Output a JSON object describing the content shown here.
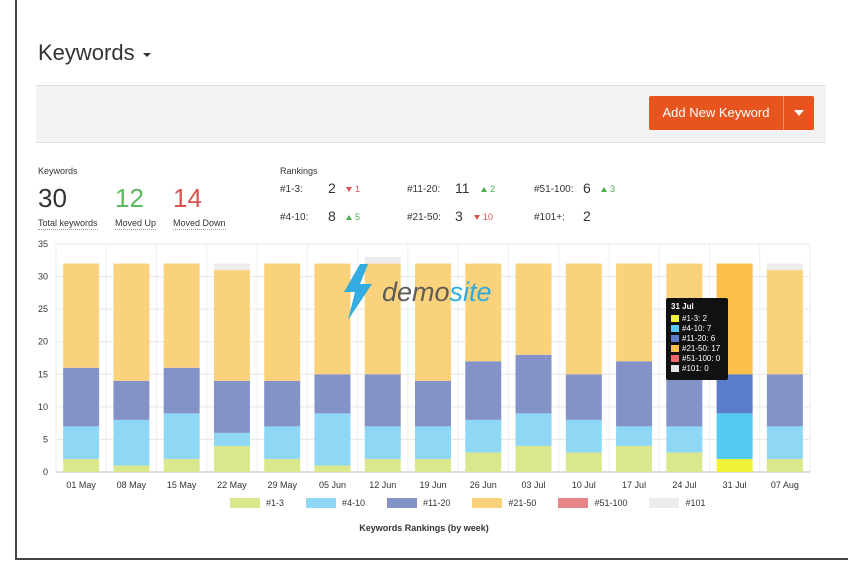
{
  "header": {
    "title": "Keywords"
  },
  "toolbar": {
    "add_label": "Add New Keyword"
  },
  "stats": {
    "section_label": "Keywords",
    "total": {
      "value": "30",
      "label": "Total keywords"
    },
    "up": {
      "value": "12",
      "label": "Moved Up"
    },
    "down": {
      "value": "14",
      "label": "Moved Down"
    }
  },
  "rankings": {
    "section_label": "Rankings",
    "items": [
      {
        "label": "#1-3:",
        "value": "2",
        "change": "1",
        "dir": "down"
      },
      {
        "label": "#4-10:",
        "value": "8",
        "change": "5",
        "dir": "up"
      },
      {
        "label": "#11-20:",
        "value": "11",
        "change": "2",
        "dir": "up"
      },
      {
        "label": "#21-50:",
        "value": "3",
        "change": "10",
        "dir": "down"
      },
      {
        "label": "#51-100:",
        "value": "6",
        "change": "3",
        "dir": "up"
      },
      {
        "label": "#101+:",
        "value": "2",
        "change": "",
        "dir": ""
      }
    ]
  },
  "watermark": {
    "brand": "demosite"
  },
  "tooltip": {
    "title": "31 Jul",
    "rows": [
      "#1-3: 2",
      "#4-10: 7",
      "#11-20: 6",
      "#21-50: 17",
      "#51-100: 0",
      "#101: 0"
    ]
  },
  "colors": {
    "c1_3": "#d9e88c",
    "c4_10": "#8fd8f5",
    "c11_20": "#8393c7",
    "c21_50": "#fbd27c",
    "c51_100": "#e8868a",
    "c101": "#ececec",
    "accent": "#e8541e"
  },
  "chart_data": {
    "type": "bar",
    "stacked": true,
    "title": "Keywords Rankings (by week)",
    "categories": [
      "01 May",
      "08 May",
      "15 May",
      "22 May",
      "29 May",
      "05 Jun",
      "12 Jun",
      "19 Jun",
      "26 Jun",
      "03 Jul",
      "10 Jul",
      "17 Jul",
      "24 Jul",
      "31 Jul",
      "07 Aug"
    ],
    "ylim": [
      0,
      35
    ],
    "yticks": [
      0,
      5,
      10,
      15,
      20,
      25,
      30,
      35
    ],
    "grid": true,
    "legend_position": "bottom",
    "highlight_category": "31 Jul",
    "series": [
      {
        "name": "#1-3",
        "color_key": "c1_3",
        "values": [
          2,
          1,
          2,
          4,
          2,
          1,
          2,
          2,
          3,
          4,
          3,
          4,
          3,
          2,
          2
        ]
      },
      {
        "name": "#4-10",
        "color_key": "c4_10",
        "values": [
          5,
          7,
          7,
          2,
          5,
          8,
          5,
          5,
          5,
          5,
          5,
          3,
          4,
          7,
          5
        ]
      },
      {
        "name": "#11-20",
        "color_key": "c11_20",
        "values": [
          9,
          6,
          7,
          8,
          7,
          6,
          8,
          7,
          9,
          9,
          7,
          10,
          8,
          6,
          8
        ]
      },
      {
        "name": "#21-50",
        "color_key": "c21_50",
        "values": [
          16,
          18,
          16,
          17,
          18,
          17,
          17,
          18,
          15,
          14,
          17,
          15,
          17,
          17,
          16
        ]
      },
      {
        "name": "#51-100",
        "color_key": "c51_100",
        "values": [
          0,
          0,
          0,
          0,
          0,
          0,
          0,
          0,
          0,
          0,
          0,
          0,
          0,
          0,
          0
        ]
      },
      {
        "name": "#101",
        "color_key": "c101",
        "values": [
          0,
          0,
          0,
          1,
          0,
          0,
          1,
          0,
          0,
          0,
          0,
          0,
          0,
          0,
          1
        ]
      }
    ]
  }
}
